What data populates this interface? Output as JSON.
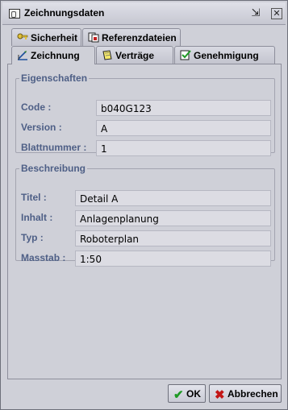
{
  "window": {
    "title": "Zeichnungsdaten",
    "minimize_icon": "⇲",
    "close_icon": "✕"
  },
  "tabs": {
    "back_row": [
      {
        "label": "Sicherheit",
        "icon": "keys-icon"
      },
      {
        "label": "Referenzdateien",
        "icon": "reference-files-icon"
      }
    ],
    "front_row": [
      {
        "label": "Zeichnung",
        "icon": "drawing-icon",
        "active": true
      },
      {
        "label": "Verträge",
        "icon": "contract-icon"
      },
      {
        "label": "Genehmigung",
        "icon": "approval-icon"
      }
    ]
  },
  "eigenschaften": {
    "legend": "Eigenschaften",
    "code_label": "Code :",
    "code_value": "b040G123",
    "version_label": "Version :",
    "version_value": "A",
    "blatt_label": "Blattnummer :",
    "blatt_value": "1"
  },
  "beschreibung": {
    "legend": "Beschreibung",
    "titel_label": "Titel :",
    "titel_value": "Detail A",
    "inhalt_label": "Inhalt :",
    "inhalt_value": "Anlagenplanung",
    "typ_label": "Typ :",
    "typ_value": "Roboterplan",
    "masstab_label": "Masstab :",
    "masstab_value": "1:50"
  },
  "buttons": {
    "ok_label": "OK",
    "ok_icon": "✔",
    "cancel_label": "Abbrechen",
    "cancel_icon": "✖"
  }
}
